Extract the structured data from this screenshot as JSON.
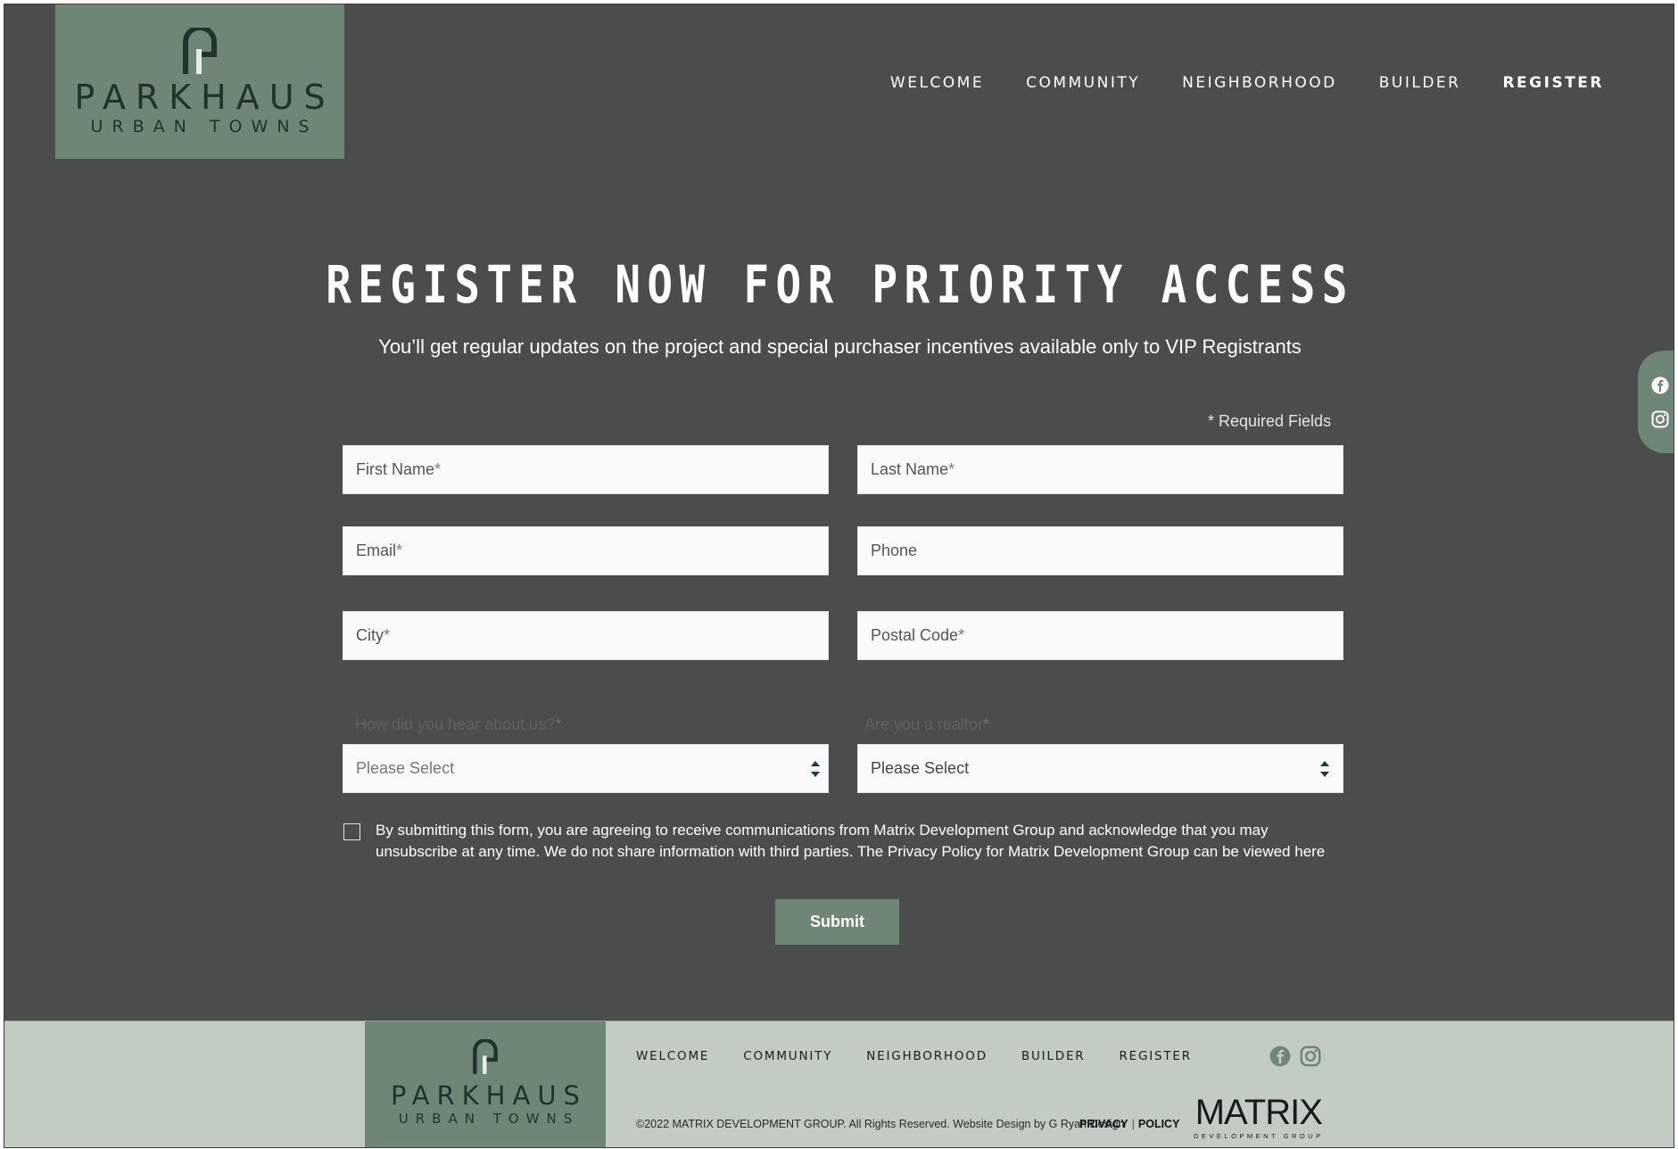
{
  "brand": {
    "name": "PARKHAUS",
    "tagline": "URBAN TOWNS"
  },
  "nav": {
    "items": [
      "WELCOME",
      "COMMUNITY",
      "NEIGHBORHOOD",
      "BUILDER",
      "REGISTER"
    ],
    "active": "REGISTER"
  },
  "hero": {
    "title": "REGISTER NOW FOR PRIORITY ACCESS",
    "subtitle": "You’ll get regular updates on the project and special purchaser incentives available only to VIP Registrants"
  },
  "form": {
    "required_note": "* Required Fields",
    "first_name": "First Name",
    "last_name": "Last Name",
    "email": "Email",
    "phone": "Phone",
    "city": "City",
    "postal_code": "Postal Code",
    "hear_about_label": "How did you hear about us?",
    "hear_about_value": "Please Select",
    "realtor_label": "Are you a realtor",
    "realtor_value": "Please Select",
    "required_star": "*",
    "consent_text": "By submitting this form, you are agreeing to receive communications from Matrix Development Group and acknowledge that you may unsubscribe at any time. We do not share information with third parties. The Privacy Policy for Matrix Development Group can be viewed here",
    "submit_label": "Submit"
  },
  "footer": {
    "nav": [
      "WELCOME",
      "COMMUNITY",
      "NEIGHBORHOOD",
      "BUILDER",
      "REGISTER"
    ],
    "copyright": "©2022 MATRIX DEVELOPMENT GROUP. All Rights Reserved. Website Design by G Ryan Design",
    "privacy": "PRIVACY",
    "policy": "POLICY",
    "separator": "|",
    "matrix_name": "MATRIX",
    "matrix_sub": "DEVELOPMENT GROUP"
  },
  "social": {
    "icons": [
      "facebook-icon",
      "instagram-icon"
    ]
  },
  "colors": {
    "background": "#4b4d4d",
    "accent": "#6f8676",
    "footer_bg": "#c3ccc3",
    "logo_ink": "#1f332a"
  }
}
